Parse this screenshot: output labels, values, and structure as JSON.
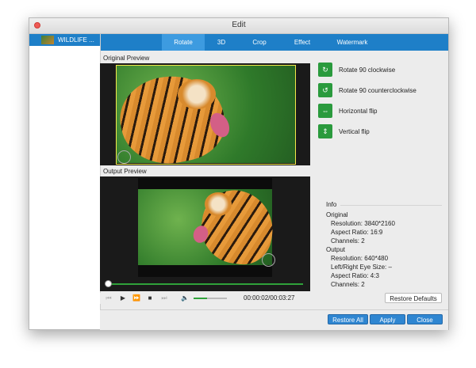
{
  "window": {
    "title": "Edit"
  },
  "sidebar": {
    "file_label": "WILDLIFE ..."
  },
  "tabs": [
    {
      "label": "Rotate",
      "active": true
    },
    {
      "label": "3D"
    },
    {
      "label": "Crop"
    },
    {
      "label": "Effect"
    },
    {
      "label": "Watermark"
    }
  ],
  "preview": {
    "original_label": "Original Preview",
    "output_label": "Output Preview"
  },
  "actions": [
    {
      "label": "Rotate 90 clockwise",
      "icon": "rotate-cw-icon"
    },
    {
      "label": "Rotate 90 counterclockwise",
      "icon": "rotate-ccw-icon"
    },
    {
      "label": "Horizontal flip",
      "icon": "horizontal-flip-icon"
    },
    {
      "label": "Vertical flip",
      "icon": "vertical-flip-icon"
    }
  ],
  "info": {
    "title": "Info",
    "original_heading": "Original",
    "original_resolution": "Resolution: 3840*2160",
    "original_aspect": "Aspect Ratio: 16:9",
    "original_channels": "Channels: 2",
    "output_heading": "Output",
    "output_resolution": "Resolution: 640*480",
    "output_eye": "Left/Right Eye Size: –",
    "output_aspect": "Aspect Ratio: 4:3",
    "output_channels": "Channels: 2"
  },
  "player": {
    "time": "00:00:02/00:03:27",
    "progress": 0.0,
    "volume": 0.4
  },
  "buttons": {
    "restore_defaults": "Restore Defaults",
    "restore_all": "Restore All",
    "apply": "Apply",
    "close": "Close"
  },
  "colors": {
    "accent": "#1e7fc8",
    "action_green": "#2a9a3d",
    "progress_green": "#2fa23a",
    "selection_yellow": "#f3e84a"
  }
}
